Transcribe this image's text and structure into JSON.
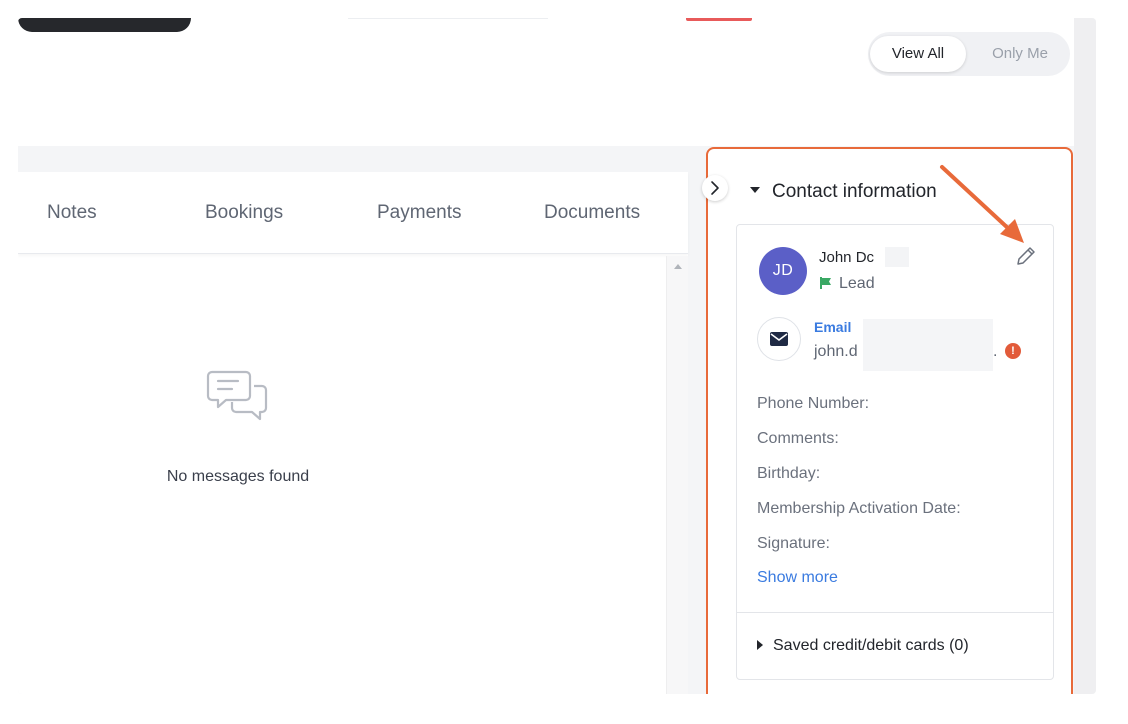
{
  "header": {
    "view_toggle": {
      "options": [
        "View All",
        "Only Me"
      ],
      "selected": "View All"
    }
  },
  "tabs": [
    {
      "label": "Notes"
    },
    {
      "label": "Bookings"
    },
    {
      "label": "Payments"
    },
    {
      "label": "Documents"
    }
  ],
  "messages": {
    "empty_text": "No messages found",
    "empty_icon": "chat-bubbles-icon"
  },
  "contact": {
    "section_title": "Contact information",
    "initials": "JD",
    "name": "John Dc",
    "status": "Lead",
    "status_color": "#3aa864",
    "avatar_color": "#5b5fc7",
    "email_label": "Email",
    "email_value": "john.d",
    "email_suffix": ".",
    "fields": [
      {
        "label": "Phone Number:"
      },
      {
        "label": "Comments:"
      },
      {
        "label": "Birthday:"
      },
      {
        "label": "Membership Activation Date:"
      },
      {
        "label": "Signature:"
      }
    ],
    "show_more": "Show more",
    "saved_cards": "Saved credit/debit cards (0)"
  },
  "colors": {
    "accent": "#3a7be0",
    "highlight": "#e86a3a",
    "warning": "#e25b3a"
  }
}
